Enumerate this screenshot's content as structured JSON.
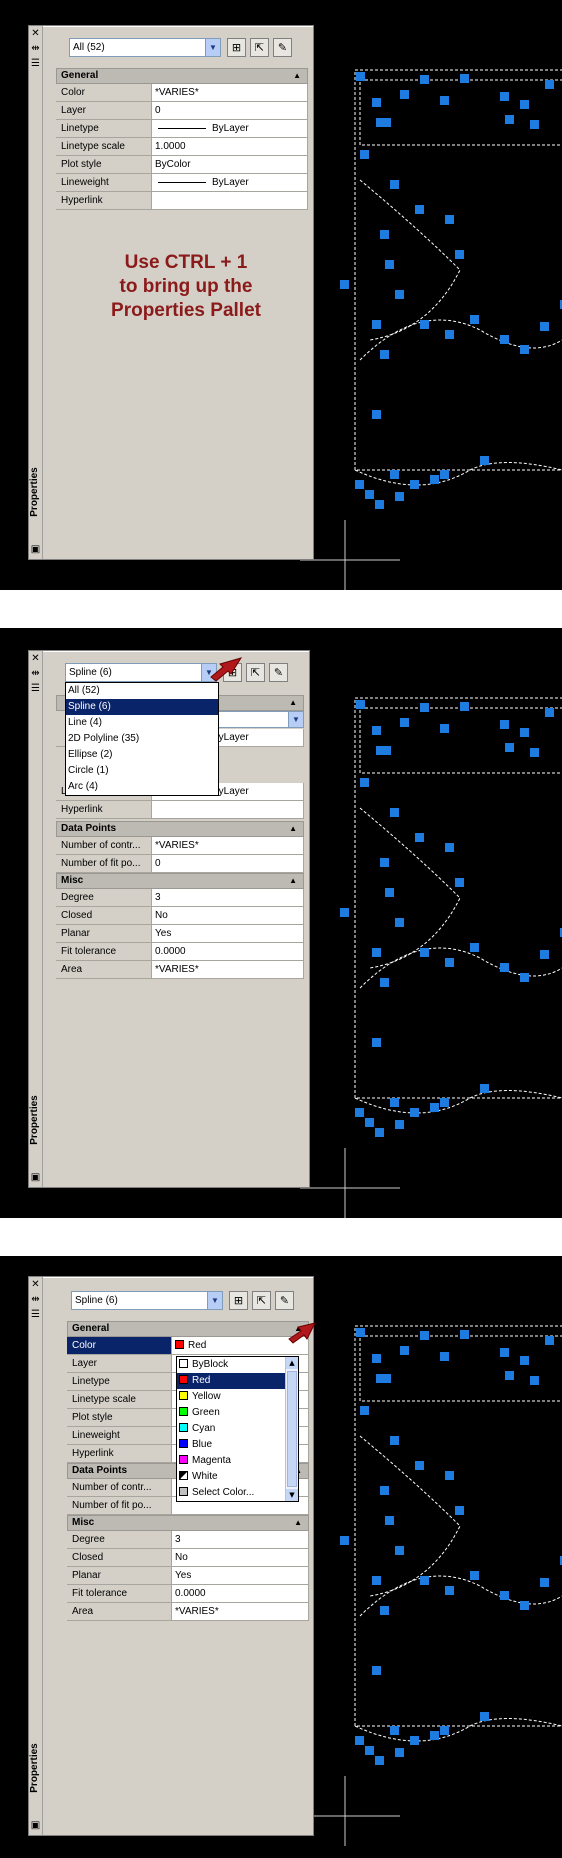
{
  "shot1": {
    "selector": "All (52)",
    "section_general": "General",
    "rows": [
      {
        "name": "Color",
        "value": "*VARIES*"
      },
      {
        "name": "Layer",
        "value": "0"
      },
      {
        "name": "Linetype",
        "value": "ByLayer"
      },
      {
        "name": "Linetype scale",
        "value": "1.0000"
      },
      {
        "name": "Plot style",
        "value": "ByColor"
      },
      {
        "name": "Lineweight",
        "value": "ByLayer"
      },
      {
        "name": "Hyperlink",
        "value": ""
      }
    ],
    "callout_lines": [
      "Use CTRL + 1",
      "to bring up the",
      "Properties Pallet"
    ],
    "palette_title": "Properties"
  },
  "shot2": {
    "selector": "Spline (6)",
    "dropdown_items": [
      "All (52)",
      "Spline (6)",
      "Line (4)",
      "2D Polyline (35)",
      "Ellipse (2)",
      "Circle (1)",
      "Arc (4)"
    ],
    "dropdown_selected_index": 1,
    "partial_rows": [
      {
        "name": "Lineweight",
        "value": "ByLayer"
      },
      {
        "name": "Hyperlink",
        "value": ""
      }
    ],
    "linetype_value": "ByLayer",
    "section_data_points": "Data Points",
    "data_point_rows": [
      {
        "name": "Number of contr...",
        "value": "*VARIES*"
      },
      {
        "name": "Number of fit po...",
        "value": "0"
      }
    ],
    "section_misc": "Misc",
    "misc_rows": [
      {
        "name": "Degree",
        "value": "3"
      },
      {
        "name": "Closed",
        "value": "No"
      },
      {
        "name": "Planar",
        "value": "Yes"
      },
      {
        "name": "Fit tolerance",
        "value": "0.0000"
      },
      {
        "name": "Area",
        "value": "*VARIES*"
      }
    ],
    "palette_title": "Properties"
  },
  "shot3": {
    "selector": "Spline (6)",
    "section_general": "General",
    "general_rows": [
      {
        "name": "Color",
        "value": "Red"
      },
      {
        "name": "Layer",
        "value": ""
      },
      {
        "name": "Linetype",
        "value": ""
      },
      {
        "name": "Linetype scale",
        "value": ""
      },
      {
        "name": "Plot style",
        "value": ""
      },
      {
        "name": "Lineweight",
        "value": ""
      },
      {
        "name": "Hyperlink",
        "value": ""
      }
    ],
    "color_items": [
      {
        "label": "ByBlock",
        "color": "#ffffff"
      },
      {
        "label": "Red",
        "color": "#ff0000"
      },
      {
        "label": "Yellow",
        "color": "#ffff00"
      },
      {
        "label": "Green",
        "color": "#00ff00"
      },
      {
        "label": "Cyan",
        "color": "#00ffff"
      },
      {
        "label": "Blue",
        "color": "#0000ff"
      },
      {
        "label": "Magenta",
        "color": "#ff00ff"
      },
      {
        "label": "White",
        "color": "#ffffff"
      },
      {
        "label": "Select Color...",
        "color": "#c0c0c0"
      }
    ],
    "color_selected_index": 1,
    "section_data_points": "Data Points",
    "data_point_rows": [
      {
        "name": "Number of contr...",
        "value": ""
      },
      {
        "name": "Number of fit po...",
        "value": ""
      }
    ],
    "section_misc": "Misc",
    "misc_rows": [
      {
        "name": "Degree",
        "value": "3"
      },
      {
        "name": "Closed",
        "value": "No"
      },
      {
        "name": "Planar",
        "value": "Yes"
      },
      {
        "name": "Fit tolerance",
        "value": "0.0000"
      },
      {
        "name": "Area",
        "value": "*VARIES*"
      }
    ],
    "palette_title": "Properties"
  },
  "colors": {
    "grip_blue": "#1e7be0",
    "callout_red": "#8b1a1a",
    "selection_navy": "#0a246a",
    "arrow_red": "#b0181b"
  }
}
